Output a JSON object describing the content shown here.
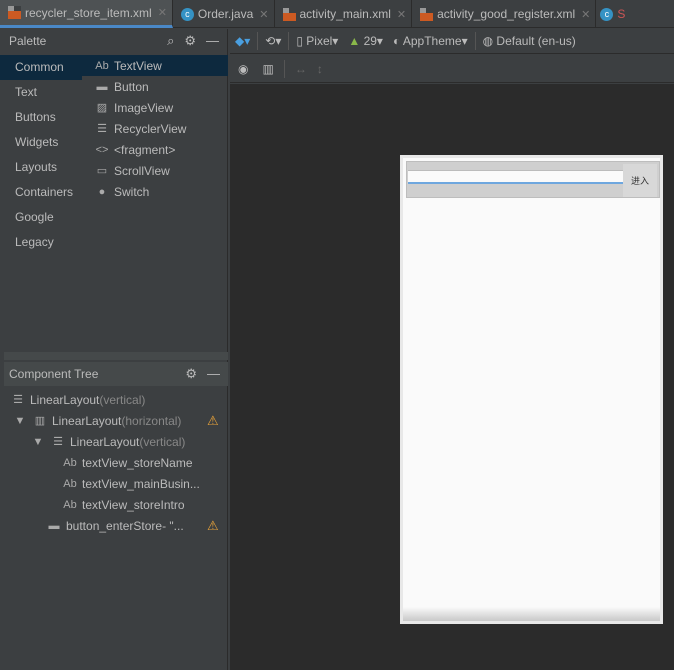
{
  "tabs": [
    {
      "label": "recycler_store_item.xml",
      "type": "xml",
      "active": true
    },
    {
      "label": "Order.java",
      "type": "java"
    },
    {
      "label": "activity_main.xml",
      "type": "xml"
    },
    {
      "label": "activity_good_register.xml",
      "type": "xml"
    },
    {
      "label": "S",
      "type": "java"
    }
  ],
  "palette": {
    "title": "Palette",
    "categories": [
      "Common",
      "Text",
      "Buttons",
      "Widgets",
      "Layouts",
      "Containers",
      "Google",
      "Legacy"
    ],
    "items": [
      {
        "icon": "Ab",
        "label": "TextView"
      },
      {
        "icon": "▬",
        "label": "Button"
      },
      {
        "icon": "▨",
        "label": "ImageView"
      },
      {
        "icon": "☰",
        "label": "RecyclerView"
      },
      {
        "icon": "<>",
        "label": "<fragment>"
      },
      {
        "icon": "▭",
        "label": "ScrollView"
      },
      {
        "icon": "●",
        "label": "Switch"
      }
    ]
  },
  "tree": {
    "title": "Component Tree",
    "nodes": [
      {
        "name": "LinearLayout",
        "hint": "(vertical)"
      },
      {
        "name": "LinearLayout",
        "hint": "(horizontal)"
      },
      {
        "name": "LinearLayout",
        "hint": "(vertical)"
      },
      {
        "name": "textView_storeName",
        "hint": ""
      },
      {
        "name": "textView_mainBusin...",
        "hint": ""
      },
      {
        "name": "textView_storeIntro",
        "hint": ""
      },
      {
        "name": "button_enterStore- \"...",
        "hint": ""
      }
    ]
  },
  "toolbar": {
    "device": "Pixel",
    "api": "29",
    "theme": "AppTheme",
    "locale": "Default (en-us)"
  },
  "preview": {
    "button_label": "进入"
  }
}
